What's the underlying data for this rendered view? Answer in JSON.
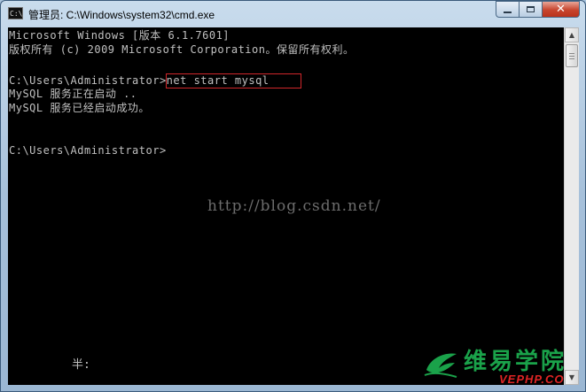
{
  "window": {
    "title": "管理员: C:\\Windows\\system32\\cmd.exe",
    "icon": "cmd-icon",
    "icon_text": "C:\\",
    "buttons": {
      "minimize": "minimize-icon",
      "maximize": "maximize-icon",
      "close": "✕"
    }
  },
  "console": {
    "lines": [
      "Microsoft Windows [版本 6.1.7601]",
      "版权所有 (c) 2009 Microsoft Corporation。保留所有权利。",
      "",
      "C:\\Users\\Administrator>net start mysql",
      "MySQL 服务正在启动 ..",
      "MySQL 服务已经启动成功。",
      "",
      "",
      "C:\\Users\\Administrator>"
    ],
    "highlighted_command": "net start mysql",
    "highlight_color": "#d0262a"
  },
  "watermark": "http://blog.csdn.net/",
  "ime_status": "半:",
  "logo": {
    "name_cn": "维易学院",
    "name_en": "VEPHP.COM",
    "colors": {
      "green": "#1aa24a",
      "red": "#e02424"
    }
  },
  "scrollbar": {
    "up": "▲",
    "down": "▼"
  }
}
